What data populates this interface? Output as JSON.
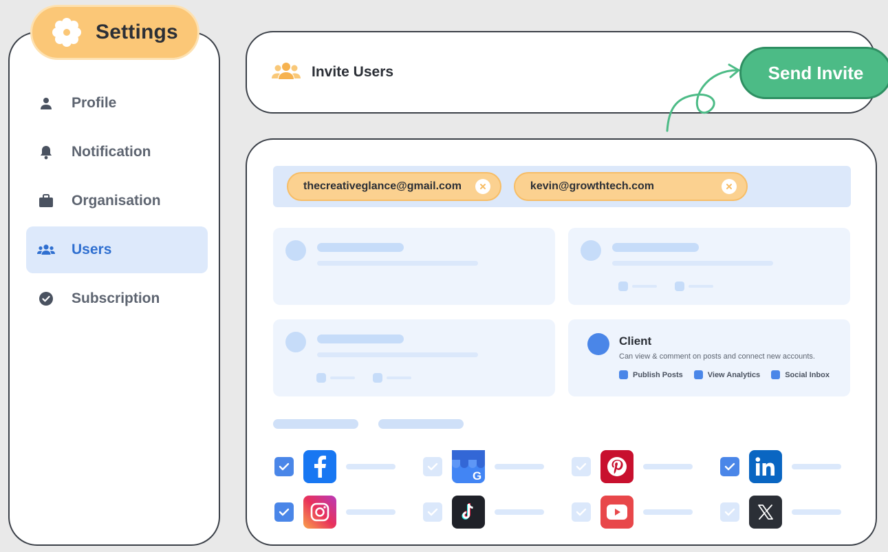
{
  "sidebar": {
    "title": "Settings",
    "items": [
      {
        "label": "Profile",
        "icon": "user-icon",
        "active": false
      },
      {
        "label": "Notification",
        "icon": "bell-icon",
        "active": false
      },
      {
        "label": "Organisation",
        "icon": "briefcase-icon",
        "active": false
      },
      {
        "label": "Users",
        "icon": "users-icon",
        "active": true
      },
      {
        "label": "Subscription",
        "icon": "check-circle-icon",
        "active": false
      }
    ]
  },
  "invite": {
    "title": "Invite Users",
    "send_label": "Send Invite"
  },
  "emails": [
    "thecreativeglance@gmail.com",
    "kevin@growthtech.com"
  ],
  "client": {
    "title": "Client",
    "description": "Can view & comment on posts and connect new accounts.",
    "permissions": [
      "Publish Posts",
      "View Analytics",
      "Social Inbox"
    ]
  },
  "social": [
    {
      "name": "facebook",
      "checked": true
    },
    {
      "name": "google-business",
      "checked": false
    },
    {
      "name": "pinterest",
      "checked": false
    },
    {
      "name": "linkedin",
      "checked": true
    },
    {
      "name": "instagram",
      "checked": true
    },
    {
      "name": "tiktok",
      "checked": false
    },
    {
      "name": "youtube",
      "checked": false
    },
    {
      "name": "x",
      "checked": false
    }
  ],
  "colors": {
    "accent": "#4a86e8",
    "send_button": "#4cbb86",
    "settings_pill": "#fbc777",
    "chip": "#fbd190"
  }
}
